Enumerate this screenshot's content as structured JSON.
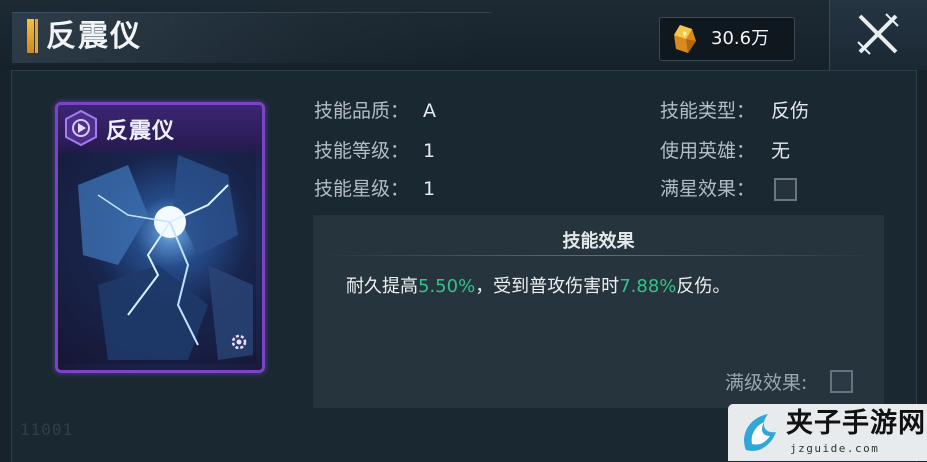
{
  "header": {
    "title": "反震仪",
    "currency_value": "30.6万",
    "currency_icon": "crystal-icon",
    "close_icon": "close-icon"
  },
  "card": {
    "name": "反震仪",
    "emblem_icon": "skill-emblem-icon",
    "gear_icon": "gear-icon",
    "accent_color": "#7b44c6"
  },
  "stats": {
    "quality_label": "技能品质：",
    "quality_value": "A",
    "level_label": "技能等级：",
    "level_value": "1",
    "star_label": "技能星级：",
    "star_value": "1",
    "type_label": "技能类型：",
    "type_value": "反伤",
    "hero_label": "使用英雄：",
    "hero_value": "无",
    "fullstar_label": "满星效果："
  },
  "effect": {
    "title": "技能效果",
    "text_1": "耐久提高",
    "value_1": "5.50%",
    "text_2": "，受到普攻伤害时",
    "value_2": "7.88%",
    "text_3": "反伤。",
    "highlight_color": "#34c28a",
    "maxlevel_label": "满级效果:"
  },
  "footer": {
    "code": "11001"
  },
  "watermark": {
    "text": "夹子手游网",
    "sub": "jzguide.com"
  }
}
